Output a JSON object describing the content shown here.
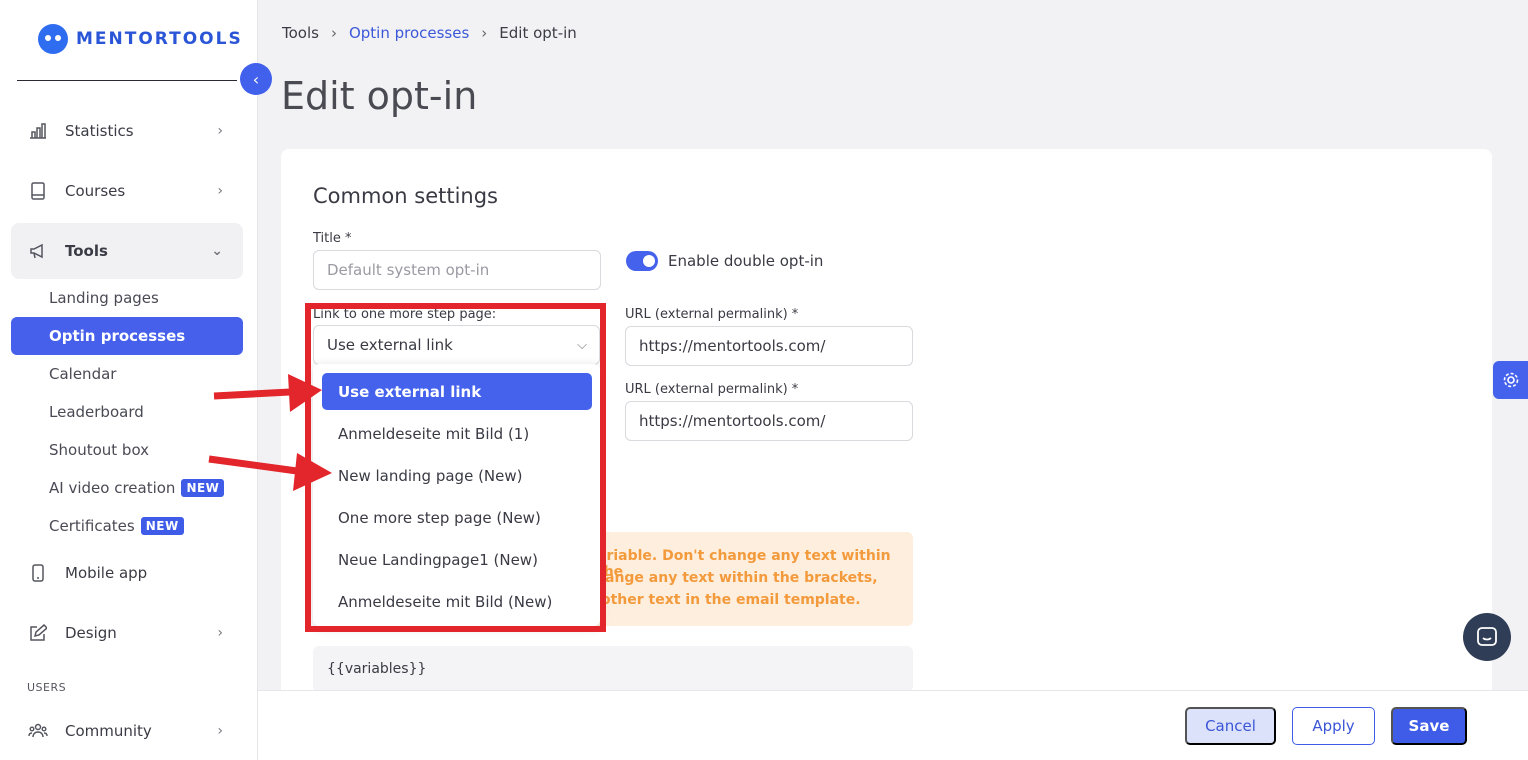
{
  "brand": {
    "name": "MENTORTOOLS"
  },
  "sidebar": {
    "items": [
      {
        "label": "Statistics"
      },
      {
        "label": "Courses"
      },
      {
        "label": "Tools"
      },
      {
        "label": "Mobile app"
      },
      {
        "label": "Design"
      },
      {
        "label": "Community"
      }
    ],
    "tools_sub": [
      {
        "label": "Landing pages"
      },
      {
        "label": "Optin processes"
      },
      {
        "label": "Calendar"
      },
      {
        "label": "Leaderboard"
      },
      {
        "label": "Shoutout box"
      },
      {
        "label": "AI video creation",
        "badge": "NEW"
      },
      {
        "label": "Certificates",
        "badge": "NEW"
      }
    ],
    "section_users": "USERS"
  },
  "breadcrumb": {
    "root": "Tools",
    "parent": "Optin processes",
    "current": "Edit opt-in"
  },
  "page_title": "Edit opt-in",
  "form": {
    "section_title": "Common settings",
    "title_label": "Title *",
    "title_placeholder": "Default system opt-in",
    "double_optin_label": "Enable double opt-in",
    "link_label": "Link to one more step page:",
    "link_value": "Use external link",
    "url_label_1": "URL (external permalink) *",
    "url_value_1": "https://mentortools.com/",
    "url_label_2": "URL (external permalink) *",
    "url_value_2": "https://mentortools.com/",
    "warning_lines": [
      "ariable. Don't change any text within the",
      "ange any text within the brackets,",
      "other text in the email template."
    ],
    "variables_text": "{{variables}}"
  },
  "dropdown_options": [
    "Use external link",
    "Anmeldeseite mit Bild (1)",
    "New landing page (New)",
    "One more step page (New)",
    "Neue Landingpage1 (New)",
    "Anmeldeseite mit Bild (New)"
  ],
  "footer": {
    "cancel": "Cancel",
    "apply": "Apply",
    "save": "Save"
  },
  "colors": {
    "accent": "#4462ec",
    "annotation": "#e2262b",
    "warning_text": "#f39a3c"
  }
}
